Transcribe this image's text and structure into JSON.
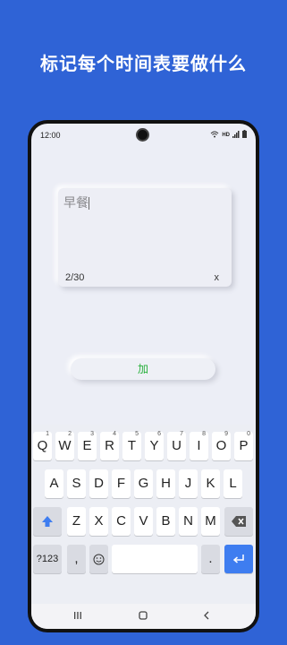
{
  "promo": {
    "title": "标记每个时间表要做什么"
  },
  "status_bar": {
    "time": "12:00",
    "hd_label": "HD"
  },
  "task_input": {
    "value": "早餐",
    "counter": "2/30",
    "clear_label": "x"
  },
  "add_button": {
    "label": "加",
    "color": "#27b03b"
  },
  "keyboard": {
    "row1": [
      {
        "key": "Q",
        "hint": "1"
      },
      {
        "key": "W",
        "hint": "2"
      },
      {
        "key": "E",
        "hint": "3"
      },
      {
        "key": "R",
        "hint": "4"
      },
      {
        "key": "T",
        "hint": "5"
      },
      {
        "key": "Y",
        "hint": "6"
      },
      {
        "key": "U",
        "hint": "7"
      },
      {
        "key": "I",
        "hint": "8"
      },
      {
        "key": "O",
        "hint": "9"
      },
      {
        "key": "P",
        "hint": "0"
      }
    ],
    "row2": [
      "A",
      "S",
      "D",
      "F",
      "G",
      "H",
      "J",
      "K",
      "L"
    ],
    "row3": [
      "Z",
      "X",
      "C",
      "V",
      "B",
      "N",
      "M"
    ],
    "symbols_label": "?123",
    "comma_label": ",",
    "period_label": ".",
    "emoji_icon": "emoji-icon",
    "shift_icon": "shift-icon",
    "backspace_icon": "backspace-icon",
    "enter_icon": "enter-icon"
  },
  "nav": {
    "recents_icon": "recents-icon",
    "home_icon": "home-icon",
    "back_icon": "back-icon"
  },
  "colors": {
    "background": "#2f63d6",
    "enter_key": "#3e7df0"
  }
}
